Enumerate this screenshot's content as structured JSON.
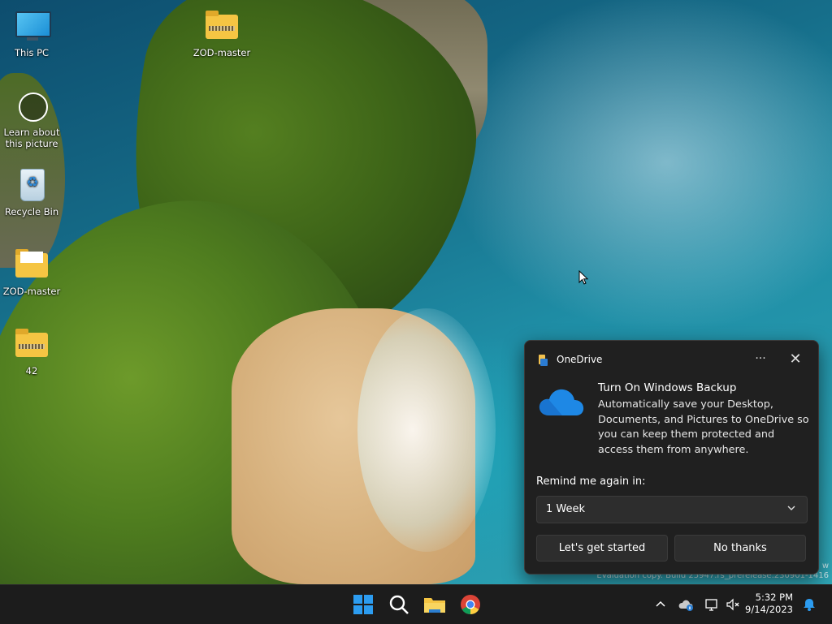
{
  "desktop": {
    "icons": [
      {
        "label": "This PC",
        "icon": "this-pc-icon"
      },
      {
        "label": "ZOD-master",
        "icon": "zip-folder-icon"
      },
      {
        "label": "Learn about this picture",
        "icon": "learn-about-picture-icon"
      },
      {
        "label": "Recycle Bin",
        "icon": "recycle-bin-icon"
      },
      {
        "label": "ZOD-master",
        "icon": "folder-icon"
      },
      {
        "label": "42",
        "icon": "zip-folder-icon"
      }
    ],
    "watermark_line1": "Evaluation copy. Build 25947.rs_prerelease.230901-1416",
    "watermark_partial": "w"
  },
  "onedrive_popup": {
    "app_name": "OneDrive",
    "more_label": "···",
    "close_label": "✕",
    "title": "Turn On Windows Backup",
    "body": "Automatically save your Desktop, Documents, and Pictures to OneDrive so you can keep them protected and access them from anywhere.",
    "remind_label": "Remind me again in:",
    "remind_value": "1 Week",
    "primary_button": "Let's get started",
    "secondary_button": "No thanks",
    "colors": {
      "background": "#202020",
      "button": "#2d2d2d",
      "cloud": "#1e88e5"
    }
  },
  "taskbar": {
    "apps": [
      {
        "name": "start-button",
        "icon": "windows-logo-icon"
      },
      {
        "name": "search-button",
        "icon": "search-icon"
      },
      {
        "name": "file-explorer-button",
        "icon": "folder-icon"
      },
      {
        "name": "chrome-button",
        "icon": "chrome-icon"
      }
    ],
    "tray": {
      "time": "5:32 PM",
      "date": "9/14/2023"
    }
  }
}
